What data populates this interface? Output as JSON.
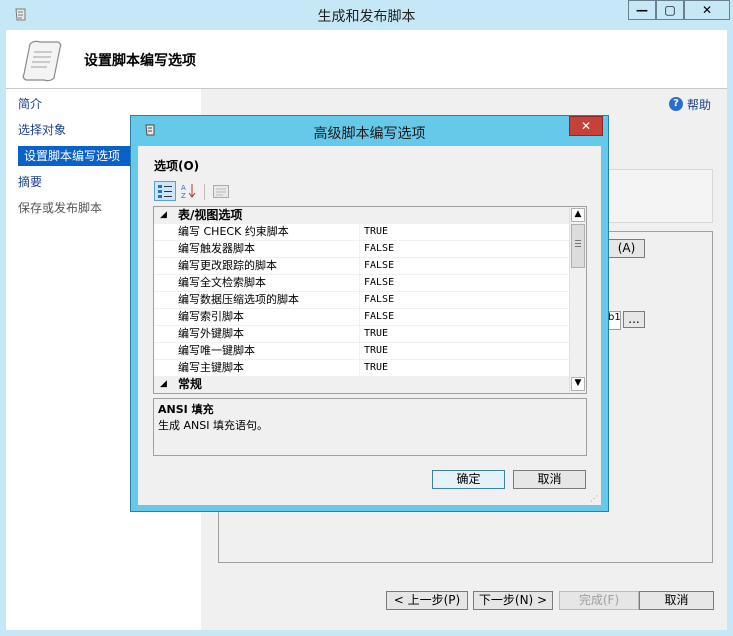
{
  "window": {
    "title": "生成和发布脚本",
    "controls": {
      "minimize": "—",
      "maximize": "▢",
      "close": "✕"
    }
  },
  "header": {
    "title": "设置脚本编写选项"
  },
  "nav": {
    "items": [
      {
        "label": "简介",
        "state": "normal"
      },
      {
        "label": "选择对象",
        "state": "normal"
      },
      {
        "label": "设置脚本编写选项",
        "state": "selected"
      },
      {
        "label": "摘要",
        "state": "normal"
      },
      {
        "label": "保存或发布脚本",
        "state": "disabled"
      }
    ]
  },
  "help": {
    "label": "帮助"
  },
  "right_panel": {
    "advanced_button_fragment": "(A)",
    "browse_button": "...",
    "path_fragment": "b1"
  },
  "footer": {
    "back": "< 上一步(P)",
    "next": "下一步(N) >",
    "finish": "完成(F)",
    "cancel": "取消"
  },
  "dialog": {
    "title": "高级脚本编写选项",
    "close": "✕",
    "options_label": "选项(O)",
    "categories": [
      {
        "name": "表/视图选项",
        "rows": [
          {
            "name": "编写 CHECK 约束脚本",
            "value": "TRUE"
          },
          {
            "name": "编写触发器脚本",
            "value": "FALSE"
          },
          {
            "name": "编写更改跟踪的脚本",
            "value": "FALSE"
          },
          {
            "name": "编写全文检索脚本",
            "value": "FALSE"
          },
          {
            "name": "编写数据压缩选项的脚本",
            "value": "FALSE"
          },
          {
            "name": "编写索引脚本",
            "value": "FALSE"
          },
          {
            "name": "编写外键脚本",
            "value": "TRUE"
          },
          {
            "name": "编写唯一键脚本",
            "value": "TRUE"
          },
          {
            "name": "编写主键脚本",
            "value": "TRUE"
          }
        ]
      },
      {
        "name": "常规",
        "rows": []
      }
    ],
    "description": {
      "title": "ANSI 填充",
      "text": "生成 ANSI 填充语句。"
    },
    "ok": "确定",
    "cancel": "取消"
  }
}
